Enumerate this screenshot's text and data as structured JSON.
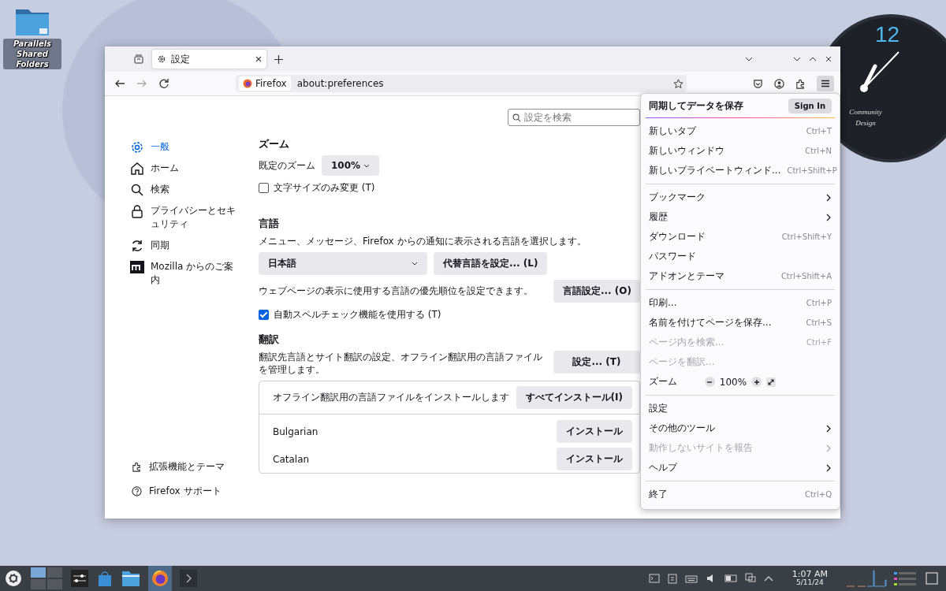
{
  "desktop_icons": [
    {
      "label": "Parallels Shared Folders"
    }
  ],
  "clock_widget": {
    "hour": "12",
    "caption": "Community Design"
  },
  "browser": {
    "tabs": [
      {
        "label": "設定",
        "selected": true
      }
    ],
    "identity": "Firefox",
    "url": "about:preferences"
  },
  "search": {
    "placeholder": "設定を検索"
  },
  "sidebar": {
    "items": [
      {
        "label": "一般",
        "selected": true
      },
      {
        "label": "ホーム",
        "selected": false
      },
      {
        "label": "検索",
        "selected": false
      },
      {
        "label": "プライバシーとセキュリティ",
        "selected": false
      },
      {
        "label": "同期",
        "selected": false
      },
      {
        "label": "Mozilla からのご案内",
        "selected": false
      }
    ],
    "footer": [
      {
        "label": "拡張機能とテーマ"
      },
      {
        "label": "Firefox サポート"
      }
    ]
  },
  "zoom": {
    "heading": "ズーム",
    "default_label": "既定のズーム",
    "default_value": "100%",
    "text_only": {
      "label": "文字サイズのみ変更 (T)",
      "checked": false
    }
  },
  "language": {
    "heading": "言語",
    "description": "メニュー、メッセージ、Firefox からの通知に表示される言語を選択します。",
    "selected_language": "日本語",
    "alternatives_button": "代替言語を設定... (L)",
    "page_description": "ウェブページの表示に使用する言語の優先順位を設定できます。",
    "page_button": "言語設定... (O)",
    "spellcheck": {
      "label": "自動スペルチェック機能を使用する (T)",
      "checked": true
    }
  },
  "translation": {
    "heading": "翻訳",
    "description": "翻訳先言語とサイト翻訳の設定、オフライン翻訳用の言語ファイルを管理します。",
    "settings_button": "設定... (T)",
    "install_all_label": "オフライン翻訳用の言語ファイルをインストールします",
    "install_all_button": "すべてインストール(I)",
    "languages": [
      {
        "name": "Bulgarian",
        "button": "インストール"
      },
      {
        "name": "Catalan",
        "button": "インストール"
      }
    ]
  },
  "menu": {
    "sync_label": "同期してデータを保存",
    "sign_in": "Sign In",
    "groups": [
      [
        {
          "kind": "item",
          "label": "新しいタブ",
          "shortcut": "Ctrl+T",
          "disabled": false
        },
        {
          "kind": "item",
          "label": "新しいウィンドウ",
          "shortcut": "Ctrl+N",
          "disabled": false
        },
        {
          "kind": "item",
          "label": "新しいプライベートウィンド...",
          "shortcut": "Ctrl+Shift+P",
          "disabled": false
        }
      ],
      [
        {
          "kind": "submenu",
          "label": "ブックマーク",
          "disabled": false
        },
        {
          "kind": "submenu",
          "label": "履歴",
          "disabled": false
        },
        {
          "kind": "item",
          "label": "ダウンロード",
          "shortcut": "Ctrl+Shift+Y",
          "disabled": false
        },
        {
          "kind": "item",
          "label": "パスワード",
          "disabled": false
        },
        {
          "kind": "item",
          "label": "アドオンとテーマ",
          "shortcut": "Ctrl+Shift+A",
          "disabled": false
        }
      ],
      [
        {
          "kind": "item",
          "label": "印刷...",
          "shortcut": "Ctrl+P",
          "disabled": false
        },
        {
          "kind": "item",
          "label": "名前を付けてページを保存...",
          "shortcut": "Ctrl+S",
          "disabled": false
        },
        {
          "kind": "item",
          "label": "ページ内を検索...",
          "shortcut": "Ctrl+F",
          "disabled": true
        },
        {
          "kind": "item",
          "label": "ページを翻訳...",
          "disabled": true
        },
        {
          "kind": "zoom",
          "label": "ズーム",
          "value": "100%"
        }
      ],
      [
        {
          "kind": "item",
          "label": "設定",
          "disabled": false
        },
        {
          "kind": "submenu",
          "label": "その他のツール",
          "disabled": false
        },
        {
          "kind": "submenu",
          "label": "動作しないサイトを報告",
          "disabled": true
        },
        {
          "kind": "submenu",
          "label": "ヘルプ",
          "disabled": false
        }
      ],
      [
        {
          "kind": "item",
          "label": "終了",
          "shortcut": "Ctrl+Q",
          "disabled": false
        }
      ]
    ]
  },
  "taskbar": {
    "time": "1:07 AM",
    "date": "5/11/24"
  }
}
